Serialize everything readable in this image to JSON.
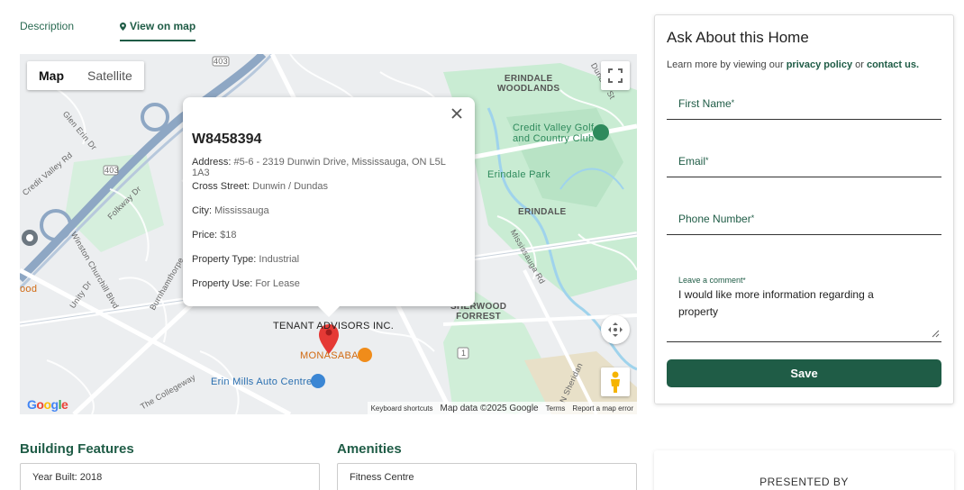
{
  "tabs": {
    "description": "Description",
    "view_on_map": "View on map"
  },
  "map": {
    "map_type": {
      "map": "Map",
      "satellite": "Satellite"
    },
    "labels": {
      "erindale_woodlands": "ERINDALE\nWOODLANDS",
      "credit_valley_golf": "Credit Valley Golf\nand Country Club",
      "erindale_park": "Erindale Park",
      "erindale": "ERINDALE",
      "sherwood_forrest": "SHERWOOD\nFORREST",
      "tenant_advisors": "TENANT ADVISORS INC.",
      "monasaba": "MONASABA",
      "erin_mills_auto": "Erin Mills Auto Centre",
      "glen_erin_dr": "Glen Erin Dr",
      "credit_valley_rd": "Credit Valley Rd",
      "folkway_dr": "Folkway Dr",
      "winston_churchill_blvd": "Winston Churchill Blvd",
      "unity_dr": "Unity Dr",
      "burnhamthorpe": "Burnhamthorpe",
      "mississauga_rd": "Mississauga Rd",
      "dundas_st": "Dundas St",
      "the_collegeway": "The Collegeway",
      "n_sheridan": "N Sheridan",
      "ood": "ood",
      "hwy_403_a": "403",
      "hwy_403_b": "403",
      "route_1": "1"
    },
    "attribution": {
      "keyboard": "Keyboard shortcuts",
      "map_data": "Map data ©2025 Google",
      "terms": "Terms",
      "report": "Report a map error"
    },
    "google": "Google"
  },
  "info_window": {
    "id": "W8458394",
    "rows": [
      {
        "label": "Address:",
        "value": "#5-6 - 2319 Dunwin Drive, Mississauga, ON L5L 1A3"
      },
      {
        "label": "Cross Street:",
        "value": "Dunwin / Dundas"
      },
      {
        "label": "City:",
        "value": "Mississauga"
      },
      {
        "label": "Price:",
        "value": "$18"
      },
      {
        "label": "Property Type:",
        "value": "Industrial"
      },
      {
        "label": "Property Use:",
        "value": "For Lease"
      }
    ]
  },
  "form": {
    "title": "Ask About this Home",
    "sub_prefix": "Learn more by viewing our ",
    "privacy_link": "privacy policy",
    "sub_or": " or ",
    "contact_link": "contact us.",
    "first_name": "First Name",
    "email": "Email",
    "phone": "Phone Number",
    "required_mark": "*",
    "comment_label": "Leave a comment",
    "comment_value": "I would like more information regarding a property",
    "save": "Save"
  },
  "sections": {
    "building_features": "Building Features",
    "year_built": "Year Built: 2018",
    "amenities": "Amenities",
    "fitness_centre": "Fitness Centre",
    "presented_by": "PRESENTED BY"
  },
  "colors": {
    "brand_green": "#1f5c46",
    "marker_red": "#e53935"
  }
}
